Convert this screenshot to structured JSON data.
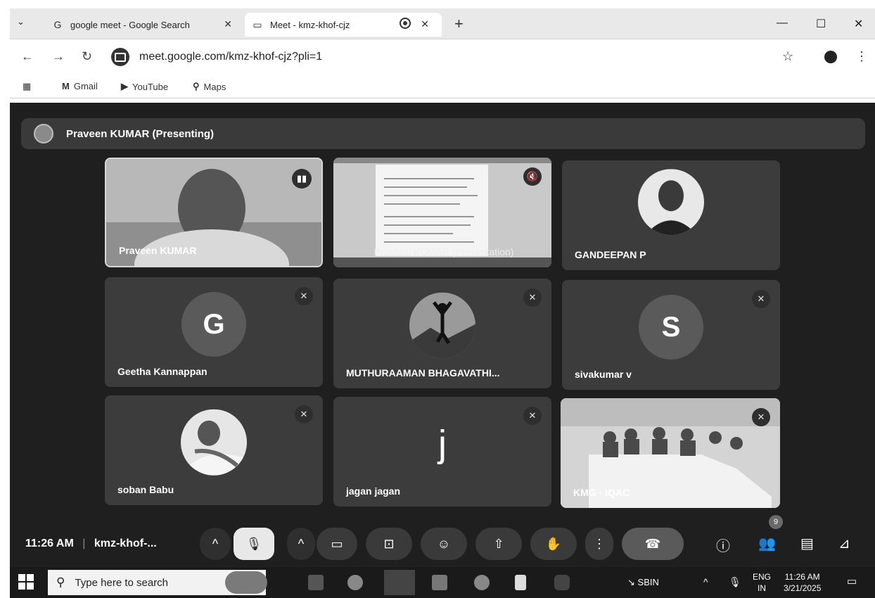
{
  "browser": {
    "tabs": [
      {
        "title": "google meet - Google Search",
        "icon": "google-icon"
      },
      {
        "title": "Meet - kmz-khof-cjz",
        "icon": "meet-icon"
      }
    ],
    "url": "meet.google.com/kmz-khof-cjz?pli=1",
    "bookmarks": [
      "Gmail",
      "YouTube",
      "Maps"
    ]
  },
  "meet": {
    "presenting_label": "Praveen KUMAR (Presenting)",
    "tiles": [
      {
        "name": "Praveen KUMAR",
        "type": "video"
      },
      {
        "name": "Praveen KUMAR (Presentation)",
        "type": "screen"
      },
      {
        "name": "GANDEEPAN P",
        "type": "photo"
      },
      {
        "name": "Geetha Kannappan",
        "type": "letter",
        "letter": "G"
      },
      {
        "name": "MUTHURAAMAN BHAGAVATHI...",
        "type": "photo"
      },
      {
        "name": "sivakumar v",
        "type": "letter",
        "letter": "S"
      },
      {
        "name": "soban Babu",
        "type": "photo"
      },
      {
        "name": "jagan jagan",
        "type": "letter",
        "letter": "j"
      },
      {
        "name": "KMG - IQAC",
        "type": "video"
      }
    ],
    "time": "11:26 AM",
    "meeting_code": "kmz-khof-...",
    "participants_count": "9"
  },
  "taskbar": {
    "search_placeholder": "Type here to search",
    "stock": "SBIN",
    "lang": "ENG",
    "region": "IN",
    "time": "11:26 AM",
    "date": "3/21/2025"
  }
}
